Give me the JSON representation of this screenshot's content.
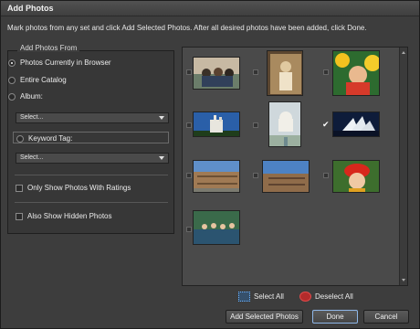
{
  "window": {
    "title": "Add Photos"
  },
  "instructions": "Mark photos from any set and click Add Selected Photos. After all desired photos have been added, click Done.",
  "source_group": {
    "label": "Add Photos From",
    "options": [
      {
        "label": "Photos Currently in Browser",
        "selected": true
      },
      {
        "label": "Entire Catalog",
        "selected": false
      },
      {
        "label": "Album:",
        "selected": false
      }
    ],
    "album_select": "Select...",
    "keyword_tag": {
      "label": "Keyword Tag:",
      "selected": false
    },
    "keyword_select": "Select...",
    "checks": [
      {
        "label": "Only Show Photos With Ratings",
        "checked": false
      },
      {
        "label": "Also Show Hidden Photos",
        "checked": false
      }
    ]
  },
  "photos": [
    {
      "name": "photo-family-group",
      "checked": false
    },
    {
      "name": "photo-vintage-child",
      "checked": false
    },
    {
      "name": "photo-child-sunflowers",
      "checked": false
    },
    {
      "name": "photo-castle",
      "checked": false
    },
    {
      "name": "photo-taj-mahal",
      "checked": false
    },
    {
      "name": "photo-opera-house",
      "checked": true
    },
    {
      "name": "photo-colosseum-1",
      "checked": false
    },
    {
      "name": "photo-colosseum-2",
      "checked": false
    },
    {
      "name": "photo-child-red-hat",
      "checked": false
    },
    {
      "name": "photo-kids-water",
      "checked": false
    }
  ],
  "selection": {
    "select_all": "Select All",
    "deselect_all": "Deselect All"
  },
  "buttons": {
    "add_selected": "Add Selected Photos",
    "done": "Done",
    "cancel": "Cancel"
  },
  "colors": {
    "accent": "#8fb7e8",
    "panel": "#4a4a4a",
    "background": "#3d3d3d"
  }
}
